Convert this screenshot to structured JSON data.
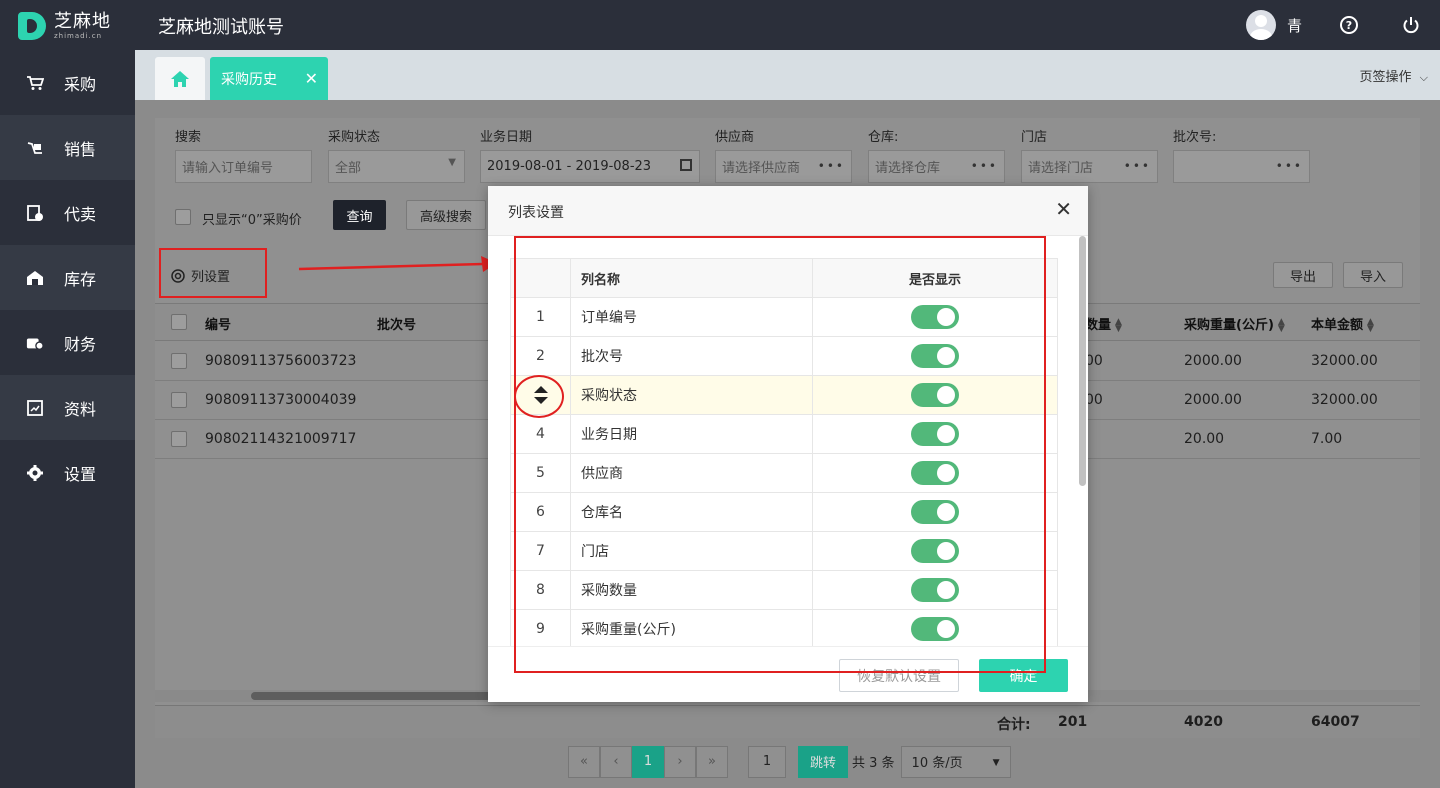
{
  "app": {
    "logo_cn": "芝麻地",
    "logo_en": "zhimadi.cn",
    "title": "芝麻地测试账号"
  },
  "user": {
    "name": "青"
  },
  "sidebar": {
    "items": [
      {
        "label": "采购",
        "icon": "cart-icon"
      },
      {
        "label": "销售",
        "icon": "sales-icon"
      },
      {
        "label": "代卖",
        "icon": "consign-icon"
      },
      {
        "label": "库存",
        "icon": "warehouse-icon"
      },
      {
        "label": "财务",
        "icon": "finance-icon"
      },
      {
        "label": "资料",
        "icon": "data-icon"
      },
      {
        "label": "设置",
        "icon": "gear-icon"
      }
    ]
  },
  "tabs": {
    "active_label": "采购历史",
    "ops_label": "页签操作"
  },
  "filters": {
    "search_label": "搜索",
    "search_placeholder": "请输入订单编号",
    "status_label": "采购状态",
    "status_value": "全部",
    "date_label": "业务日期",
    "date_value": "2019-08-01 - 2019-08-23",
    "supplier_label": "供应商",
    "supplier_placeholder": "请选择供应商",
    "warehouse_label": "仓库:",
    "warehouse_placeholder": "请选择仓库",
    "store_label": "门店",
    "store_placeholder": "请选择门店",
    "batch_label": "批次号:",
    "zero_price_label": "只显示“0”采购价",
    "query_btn": "查询",
    "advanced_btn": "高级搜索"
  },
  "toolbar": {
    "col_settings": "列设置",
    "export_btn": "导出",
    "import_btn": "导入"
  },
  "table": {
    "headers": {
      "no": "编号",
      "batch": "批次号",
      "qty": "数量",
      "weight": "采购重量(公斤)",
      "amount": "本单金额"
    },
    "rows": [
      {
        "no": "90809113756003723",
        "qty": "00",
        "weight": "2000.00",
        "amount": "32000.00"
      },
      {
        "no": "90809113730004039",
        "qty": "00",
        "weight": "2000.00",
        "amount": "32000.00"
      },
      {
        "no": "90802114321009717",
        "qty": "",
        "weight": "20.00",
        "amount": "7.00"
      }
    ],
    "totals": {
      "label": "合计:",
      "qty": "201",
      "weight": "4020",
      "amount": "64007"
    }
  },
  "pager": {
    "current": "1",
    "jump_value": "1",
    "jump_btn": "跳转",
    "total": "共 3 条",
    "page_size": "10 条/页"
  },
  "modal": {
    "title": "列表设置",
    "col_name_header": "列名称",
    "show_header": "是否显示",
    "rows": [
      {
        "index": "1",
        "name": "订单编号",
        "shown": true
      },
      {
        "index": "2",
        "name": "批次号",
        "shown": true
      },
      {
        "index": "",
        "name": "采购状态",
        "shown": true
      },
      {
        "index": "4",
        "name": "业务日期",
        "shown": true
      },
      {
        "index": "5",
        "name": "供应商",
        "shown": true
      },
      {
        "index": "6",
        "name": "仓库名",
        "shown": true
      },
      {
        "index": "7",
        "name": "门店",
        "shown": true
      },
      {
        "index": "8",
        "name": "采购数量",
        "shown": true
      },
      {
        "index": "9",
        "name": "采购重量(公斤)",
        "shown": true
      }
    ],
    "reset_btn": "恢复默认设置",
    "ok_btn": "确定"
  },
  "colors": {
    "accent": "#2dd3b0",
    "toggle_on": "#52b87a",
    "annotation_red": "#e02020",
    "dark_bar": "#2b2f3a"
  }
}
